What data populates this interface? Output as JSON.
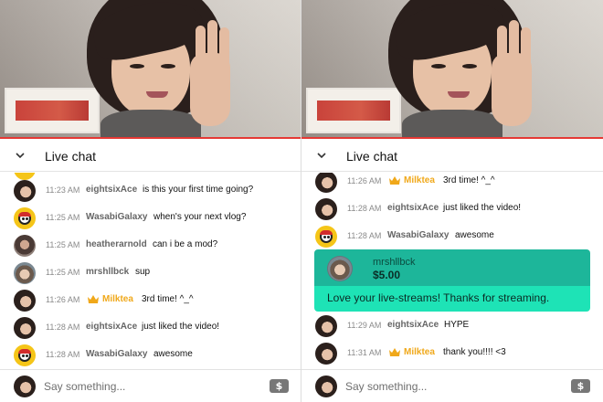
{
  "header": {
    "title": "Live chat"
  },
  "input": {
    "placeholder": "Say something..."
  },
  "icons": {
    "collapse": "chevron-down-icon",
    "moderator": "crown-icon",
    "super_chat": "dollar-icon"
  },
  "colors": {
    "accent": "#e53935",
    "moderator": "#f0a81a",
    "super_chat_top": "#1db69a",
    "super_chat_bottom": "#1ee3b6"
  },
  "left": {
    "messages": [
      {
        "time": "11:23 AM",
        "author": "eightsixAce",
        "text": "is this your first time going?"
      },
      {
        "time": "11:25 AM",
        "author": "WasabiGalaxy",
        "text": "when's your next vlog?"
      },
      {
        "time": "11:25 AM",
        "author": "heatherarnold",
        "text": "can i be a mod?"
      },
      {
        "time": "11:25 AM",
        "author": "mrshllbck",
        "text": "sup"
      },
      {
        "time": "11:26 AM",
        "author": "Milktea",
        "text": "3rd time! ^_^"
      },
      {
        "time": "11:28 AM",
        "author": "eightsixAce",
        "text": "just liked the video!"
      },
      {
        "time": "11:28 AM",
        "author": "WasabiGalaxy",
        "text": "awesome"
      }
    ]
  },
  "right": {
    "messages": [
      {
        "time": "11:26 AM",
        "author": "Milktea",
        "text": "3rd time! ^_^"
      },
      {
        "time": "11:28 AM",
        "author": "eightsixAce",
        "text": "just liked the video!"
      },
      {
        "time": "11:28 AM",
        "author": "WasabiGalaxy",
        "text": "awesome"
      }
    ],
    "super_chat": {
      "author": "mrshllbck",
      "amount": "$5.00",
      "message": "Love your live-streams! Thanks for streaming."
    },
    "messages_after": [
      {
        "time": "11:29 AM",
        "author": "eightsixAce",
        "text": "HYPE"
      },
      {
        "time": "11:31 AM",
        "author": "Milktea",
        "text": "thank you!!!! <3"
      }
    ]
  }
}
